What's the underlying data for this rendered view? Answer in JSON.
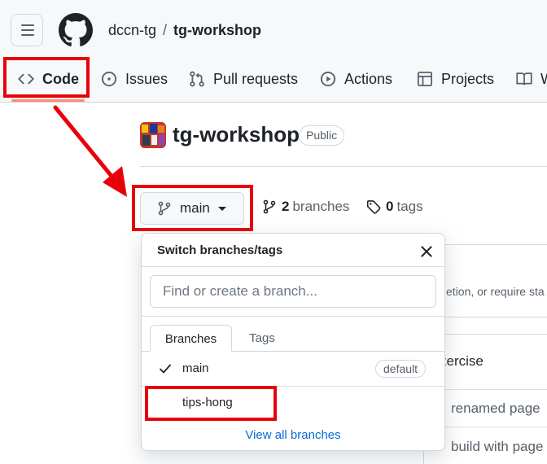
{
  "header": {
    "owner": "dccn-tg",
    "separator": "/",
    "repo": "tg-workshop"
  },
  "tabs": [
    {
      "label": "Code",
      "icon": "code-icon",
      "active": true
    },
    {
      "label": "Issues",
      "icon": "issue-opened-icon"
    },
    {
      "label": "Pull requests",
      "icon": "git-pull-request-icon"
    },
    {
      "label": "Actions",
      "icon": "play-icon"
    },
    {
      "label": "Projects",
      "icon": "table-icon"
    },
    {
      "label": "W",
      "icon": "book-icon"
    }
  ],
  "repo_header": {
    "title": "tg-workshop",
    "visibility": "Public"
  },
  "branch_bar": {
    "current_branch": "main",
    "branches_count": "2",
    "branches_label": "branches",
    "tags_count": "0",
    "tags_label": "tags"
  },
  "background": {
    "notice_fragment": "etion, or require sta",
    "commit_fragment": "xercise",
    "row1": "renamed page",
    "row2": "build with page"
  },
  "popover": {
    "title": "Switch branches/tags",
    "search_placeholder": "Find or create a branch...",
    "tabs": [
      "Branches",
      "Tags"
    ],
    "branches": [
      {
        "name": "main",
        "badge": "default",
        "selected": true
      },
      {
        "name": "tips-hong",
        "badge": "",
        "selected": false
      }
    ],
    "view_all": "View all branches"
  },
  "annotations": {
    "highlight_color": "#e8000b"
  }
}
